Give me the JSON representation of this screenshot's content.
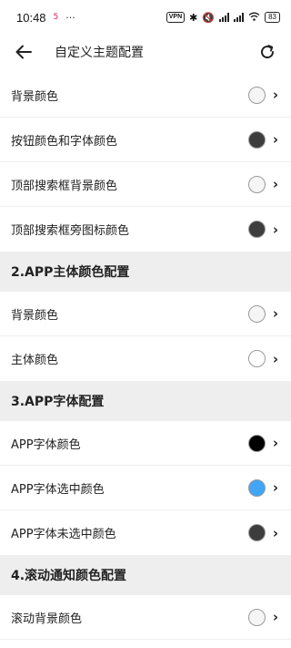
{
  "status": {
    "time": "10:48",
    "app_icon": "5",
    "dots": "···",
    "vpn": "VPN",
    "battery": "83"
  },
  "header": {
    "title": "自定义主题配置"
  },
  "rows_top": [
    {
      "label": "背景颜色",
      "color": "#f5f5f5"
    },
    {
      "label": "按钮颜色和字体颜色",
      "color": "#3d3d3d"
    },
    {
      "label": "顶部搜索框背景颜色",
      "color": "#f5f5f5"
    },
    {
      "label": "顶部搜索框旁图标颜色",
      "color": "#3d3d3d"
    }
  ],
  "section2": {
    "title": "2.APP主体颜色配置",
    "rows": [
      {
        "label": "背景颜色",
        "color": "#f5f5f5"
      },
      {
        "label": "主体颜色",
        "color": "#ffffff"
      }
    ]
  },
  "section3": {
    "title": "3.APP字体配置",
    "rows": [
      {
        "label": "APP字体颜色",
        "color": "#000000"
      },
      {
        "label": "APP字体选中颜色",
        "color": "#42a5f5"
      },
      {
        "label": "APP字体未选中颜色",
        "color": "#3d3d3d"
      }
    ]
  },
  "section4": {
    "title": "4.滚动通知颜色配置",
    "rows": [
      {
        "label": "滚动背景颜色",
        "color": "#f5f5f5"
      }
    ]
  },
  "icons": {
    "back": "arrow-left-icon",
    "refresh": "refresh-icon",
    "chevron": "chevron-right-icon"
  }
}
